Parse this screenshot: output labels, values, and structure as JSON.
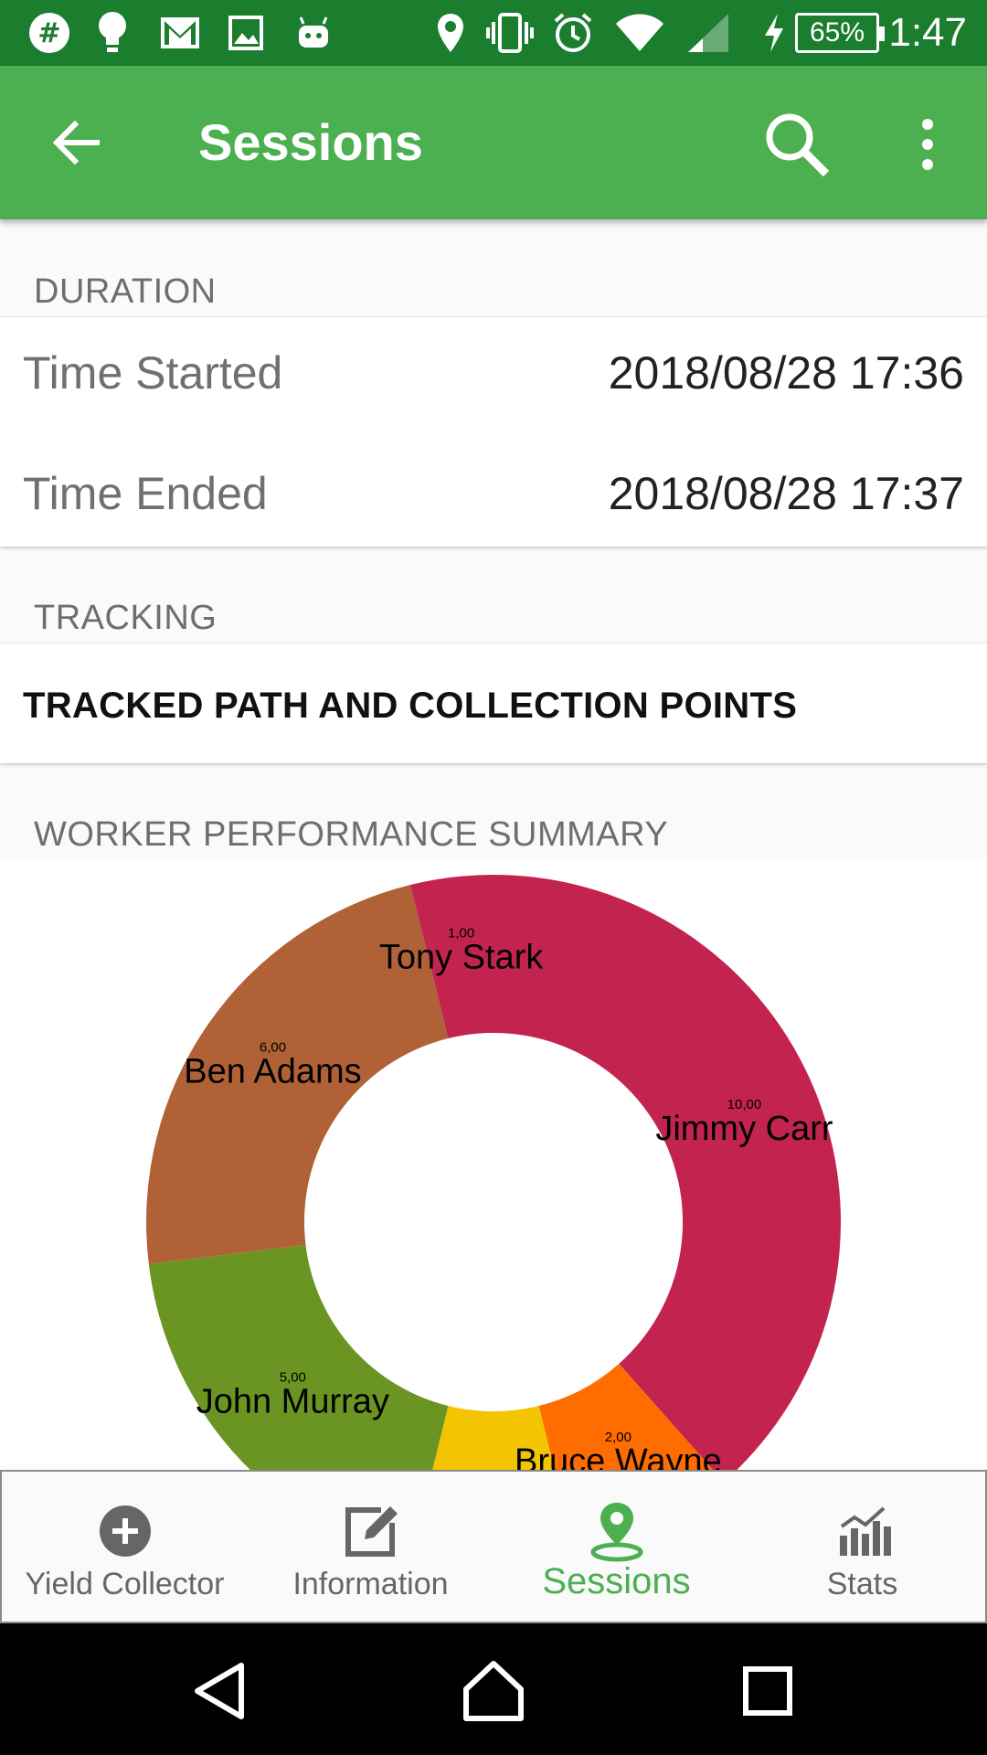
{
  "status_bar": {
    "time": "1:47",
    "battery": "65%",
    "left_icons": [
      "slack-icon",
      "bulb-icon",
      "gmail-icon",
      "image-icon",
      "android-icon"
    ],
    "right_icons": [
      "location-icon",
      "vibrate-icon",
      "alarm-icon",
      "wifi-icon",
      "signal-icon",
      "charging-icon"
    ]
  },
  "app_bar": {
    "title": "Sessions"
  },
  "duration": {
    "header": "DURATION",
    "rows": [
      {
        "label": "Time Started",
        "value": "2018/08/28 17:36"
      },
      {
        "label": "Time Ended",
        "value": "2018/08/28 17:37"
      }
    ]
  },
  "tracking": {
    "header": "TRACKING",
    "button_label": "TRACKED PATH AND COLLECTION POINTS"
  },
  "performance": {
    "header": "WORKER PERFORMANCE SUMMARY"
  },
  "chart_data": {
    "type": "pie",
    "donut": true,
    "title": "",
    "slices": [
      {
        "label": "Jimmy Carr",
        "value": 10,
        "value_label": "10,00",
        "color": "#c2244f"
      },
      {
        "label": "Bruce Wayne",
        "value": 2,
        "value_label": "2,00",
        "color": "#ff6d00"
      },
      {
        "label": "",
        "value": 2,
        "value_label": "",
        "color": "#f2c500"
      },
      {
        "label": "John Murray",
        "value": 5,
        "value_label": "5,00",
        "color": "#6a9522"
      },
      {
        "label": "Ben Adams",
        "value": 6,
        "value_label": "6,00",
        "color": "#b06236"
      },
      {
        "label": "Tony Stark",
        "value": 1,
        "value_label": "1,00",
        "color": "#c2244f"
      }
    ]
  },
  "bottom_nav": {
    "items": [
      {
        "label": "Yield Collector",
        "icon": "add-circle-icon",
        "active": false
      },
      {
        "label": "Information",
        "icon": "edit-note-icon",
        "active": false
      },
      {
        "label": "Sessions",
        "icon": "location-pin-icon",
        "active": true
      },
      {
        "label": "Stats",
        "icon": "bar-chart-icon",
        "active": false
      }
    ],
    "active_color": "#4caf50"
  },
  "colors": {
    "status_bar": "#1b7d2e",
    "app_bar": "#4caf50",
    "background": "#fafafa"
  }
}
